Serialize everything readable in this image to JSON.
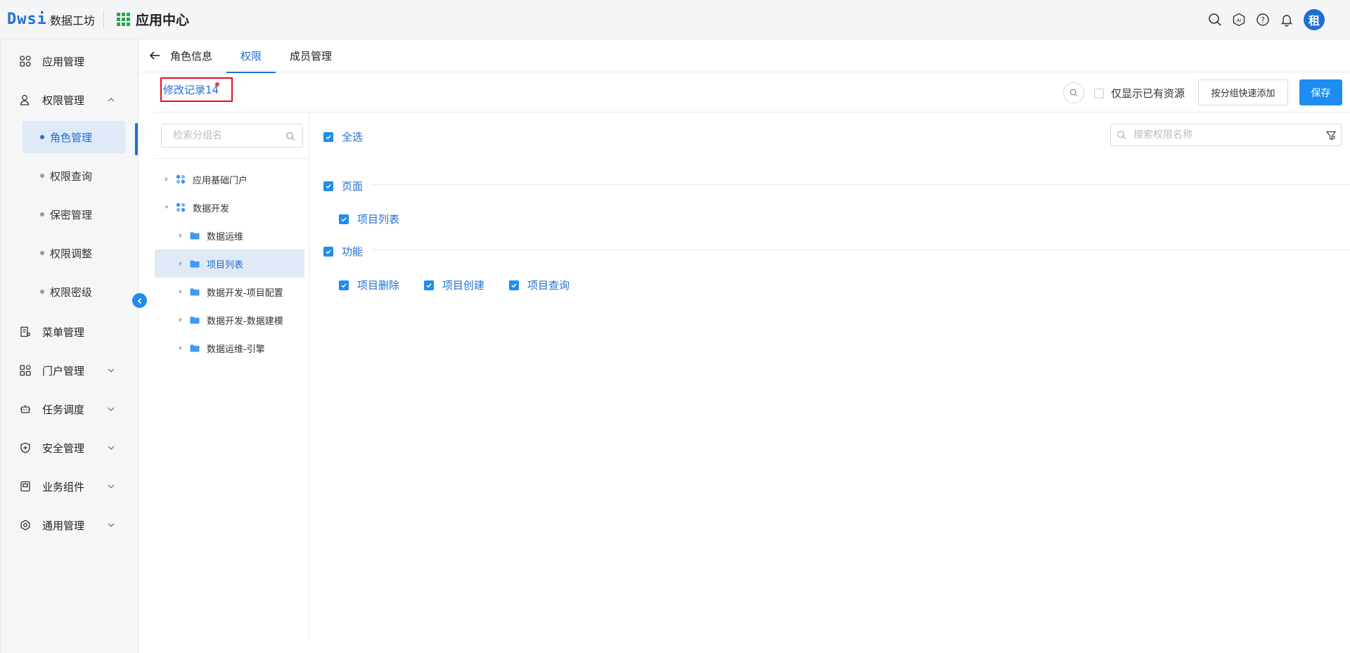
{
  "header": {
    "logo_mark": "Dwsi",
    "logo_text": "数据工坊",
    "app_title": "应用中心",
    "avatar_text": "租"
  },
  "sidebar": {
    "items": [
      {
        "label": "应用管理",
        "icon": "apps-icon"
      },
      {
        "label": "权限管理",
        "icon": "user-lock-icon",
        "expanded": true
      },
      {
        "label": "菜单管理",
        "icon": "menu-doc-icon"
      },
      {
        "label": "门户管理",
        "icon": "portal-icon"
      },
      {
        "label": "任务调度",
        "icon": "robot-icon"
      },
      {
        "label": "安全管理",
        "icon": "shield-icon"
      },
      {
        "label": "业务组件",
        "icon": "component-icon"
      },
      {
        "label": "通用管理",
        "icon": "settings-icon"
      }
    ],
    "sub_items": [
      {
        "label": "角色管理",
        "active": true
      },
      {
        "label": "权限查询"
      },
      {
        "label": "保密管理"
      },
      {
        "label": "权限调整"
      },
      {
        "label": "权限密级"
      }
    ]
  },
  "tabs": [
    {
      "label": "角色信息"
    },
    {
      "label": "权限",
      "active": true
    },
    {
      "label": "成员管理"
    }
  ],
  "toolbar": {
    "modlog_label": "修改记录14",
    "only_existing_label": "仅显示已有资源",
    "quick_add_label": "按分组快速添加",
    "save_label": "保存"
  },
  "tree": {
    "search_placeholder": "检索分组名",
    "nodes": [
      {
        "label": "应用基础门户",
        "level": 0,
        "expanded": false,
        "icon": "app-group-icon"
      },
      {
        "label": "数据开发",
        "level": 0,
        "expanded": true,
        "icon": "app-group-icon"
      },
      {
        "label": "数据运维",
        "level": 1,
        "icon": "folder-icon"
      },
      {
        "label": "项目列表",
        "level": 1,
        "icon": "folder-icon",
        "selected": true
      },
      {
        "label": "数据开发-项目配置",
        "level": 1,
        "icon": "folder-icon"
      },
      {
        "label": "数据开发-数据建模",
        "level": 1,
        "icon": "folder-icon"
      },
      {
        "label": "数据运维-引擎",
        "level": 1,
        "icon": "folder-icon"
      }
    ]
  },
  "permissions": {
    "select_all_label": "全选",
    "search_placeholder": "搜索权限名称",
    "sections": [
      {
        "label": "页面",
        "items": [
          "项目列表"
        ]
      },
      {
        "label": "功能",
        "items": [
          "项目删除",
          "项目创建",
          "项目查询"
        ]
      }
    ]
  },
  "colors": {
    "primary": "#1f8cf0",
    "link": "#1f6fd6",
    "highlight_border": "#e0101f",
    "selected_bg": "#dfe9f7"
  }
}
